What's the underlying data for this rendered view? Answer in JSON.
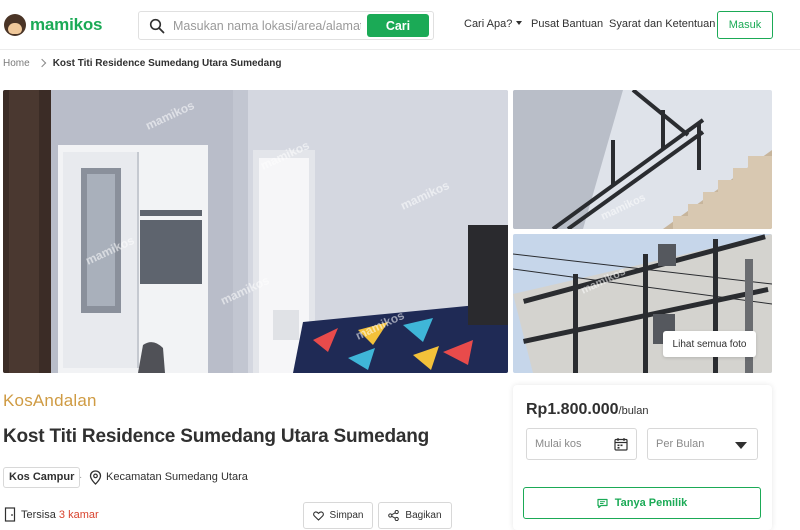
{
  "brand": {
    "name": "mamikos",
    "color": "#1baa56"
  },
  "search": {
    "placeholder": "Masukan nama lokasi/area/alamat",
    "button": "Cari"
  },
  "nav": {
    "items": [
      "Cari Apa?",
      "Pusat Bantuan",
      "Syarat dan Ketentuan"
    ],
    "login": "Masuk"
  },
  "breadcrumb": {
    "home": "Home",
    "current": "Kost Titi Residence Sumedang Utara Sumedang"
  },
  "gallery": {
    "watermark": "mamikos",
    "see_all": "Lihat semua foto",
    "photos": [
      "room-interior",
      "staircase",
      "building-exterior"
    ]
  },
  "listing": {
    "badge": "KosAndalan",
    "badge_color": "#cf9b43",
    "title": "Kost Titi Residence Sumedang Utara Sumedang",
    "type": "Kos Campur",
    "separator": "·",
    "location": "Kecamatan Sumedang Utara",
    "remaining_prefix": "Tersisa",
    "remaining_count": "3 kamar",
    "remaining_color": "#d8432e",
    "save": "Simpan",
    "share": "Bagikan"
  },
  "booking": {
    "price": "Rp1.800.000",
    "unit": "/bulan",
    "start_placeholder": "Mulai kos",
    "period_value": "Per Bulan",
    "contact": "Tanya Pemilik"
  },
  "icons": [
    "search-icon",
    "chevron-right-icon",
    "caret-down-icon",
    "location-pin-icon",
    "door-icon",
    "heart-icon",
    "share-icon",
    "calendar-icon",
    "chat-icon"
  ]
}
